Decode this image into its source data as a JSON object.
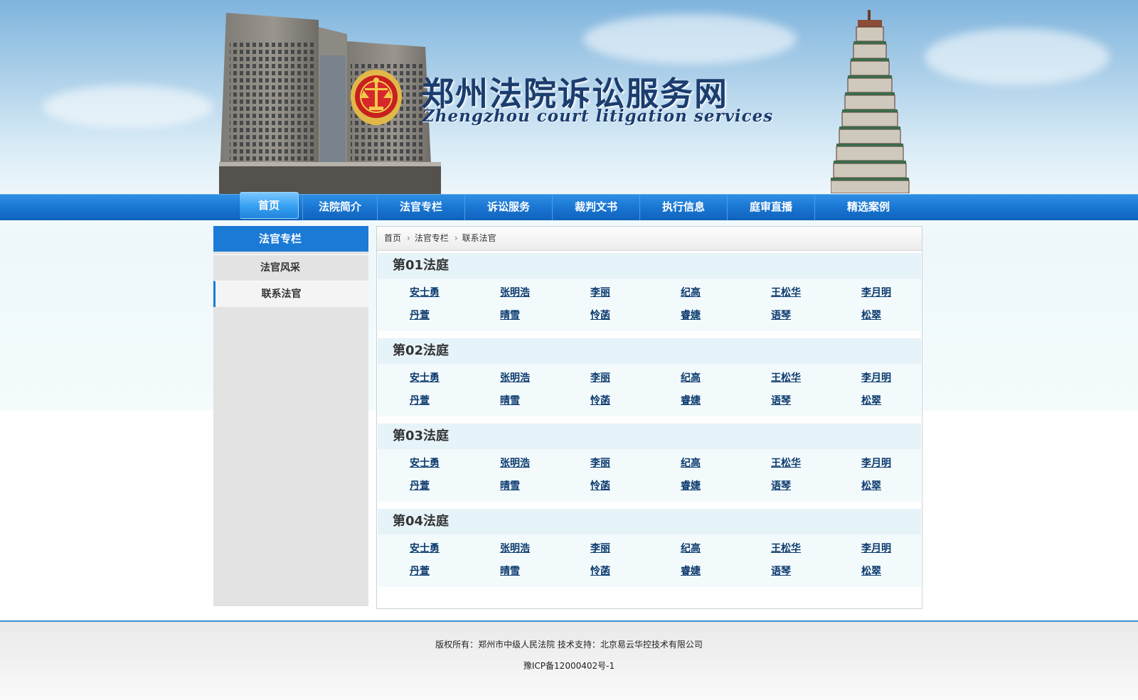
{
  "header": {
    "title": "郑州法院诉讼服务网",
    "subtitle": "Zhengzhou court litigation services"
  },
  "nav": [
    "首页",
    "法院简介",
    "法官专栏",
    "诉讼服务",
    "裁判文书",
    "执行信息",
    "庭审直播",
    "精选案例"
  ],
  "sidebar": {
    "heading": "法官专栏",
    "items": [
      "法官风采",
      "联系法官"
    ]
  },
  "breadcrumb": [
    "首页",
    "法官专栏",
    "联系法官"
  ],
  "courts": [
    {
      "title": "第01法庭",
      "names": [
        "安士勇",
        "张明浩",
        "李丽",
        "纪高",
        "王松华",
        "李月明",
        "丹萱",
        "晴雪",
        "怜菡",
        "睿婕",
        "语琴",
        "松翠"
      ]
    },
    {
      "title": "第02法庭",
      "names": [
        "安士勇",
        "张明浩",
        "李丽",
        "纪高",
        "王松华",
        "李月明",
        "丹萱",
        "晴雪",
        "怜菡",
        "睿婕",
        "语琴",
        "松翠"
      ]
    },
    {
      "title": "第03法庭",
      "names": [
        "安士勇",
        "张明浩",
        "李丽",
        "纪高",
        "王松华",
        "李月明",
        "丹萱",
        "晴雪",
        "怜菡",
        "睿婕",
        "语琴",
        "松翠"
      ]
    },
    {
      "title": "第04法庭",
      "names": [
        "安士勇",
        "张明浩",
        "李丽",
        "纪高",
        "王松华",
        "李月明",
        "丹萱",
        "晴雪",
        "怜菡",
        "睿婕",
        "语琴",
        "松翠"
      ]
    }
  ],
  "footer": {
    "copyright": "版权所有：郑州市中级人民法院  技术支持：北京易云华控技术有限公司",
    "icp": "豫ICP备12000402号-1"
  },
  "colors": {
    "nav_blue": "#1a76d2",
    "title_navy": "#1b3c6e",
    "link": "#0b3a6e"
  }
}
